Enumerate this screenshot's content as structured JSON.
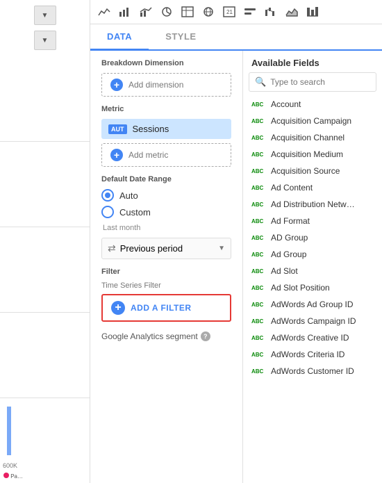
{
  "sidebar": {
    "arrow1": "▼",
    "arrow2": "▼",
    "chart_label": "600K"
  },
  "toolbar": {
    "icons": [
      "line-chart",
      "bar-chart",
      "combo-chart",
      "pie-chart",
      "table-chart",
      "geo-chart",
      "scorecard",
      "timeline",
      "scatter",
      "bullet",
      "treemap"
    ]
  },
  "tabs": [
    {
      "label": "DATA",
      "active": true
    },
    {
      "label": "STYLE",
      "active": false
    }
  ],
  "config": {
    "breakdown_dimension_label": "Breakdown Dimension",
    "add_dimension_label": "Add dimension",
    "metric_label": "Metric",
    "metric_badge": "AUT",
    "metric_name": "Sessions",
    "add_metric_label": "Add metric",
    "date_range_label": "Default Date Range",
    "radio_auto_label": "Auto",
    "radio_custom_label": "Custom",
    "sub_date_label": "Last month",
    "previous_period_label": "Previous period",
    "filter_label": "Filter",
    "time_series_filter_label": "Time Series Filter",
    "add_filter_label": "ADD A FILTER",
    "google_analytics_label": "Google Analytics segment",
    "search_placeholder": "Type to search"
  },
  "available_fields": {
    "header": "Available Fields",
    "items": [
      {
        "type": "ABC",
        "name": "Account"
      },
      {
        "type": "ABC",
        "name": "Acquisition Campaign"
      },
      {
        "type": "ABC",
        "name": "Acquisition Channel"
      },
      {
        "type": "ABC",
        "name": "Acquisition Medium"
      },
      {
        "type": "ABC",
        "name": "Acquisition Source"
      },
      {
        "type": "ABC",
        "name": "Ad Content"
      },
      {
        "type": "ABC",
        "name": "Ad Distribution Netw…"
      },
      {
        "type": "ABC",
        "name": "Ad Format"
      },
      {
        "type": "ABC",
        "name": "AD Group"
      },
      {
        "type": "ABC",
        "name": "Ad Group"
      },
      {
        "type": "ABC",
        "name": "Ad Slot"
      },
      {
        "type": "ABC",
        "name": "Ad Slot Position"
      },
      {
        "type": "ABC",
        "name": "AdWords Ad Group ID"
      },
      {
        "type": "ABC",
        "name": "AdWords Campaign ID"
      },
      {
        "type": "ABC",
        "name": "AdWords Creative ID"
      },
      {
        "type": "ABC",
        "name": "AdWords Criteria ID"
      },
      {
        "type": "ABC",
        "name": "AdWords Customer ID"
      }
    ]
  }
}
